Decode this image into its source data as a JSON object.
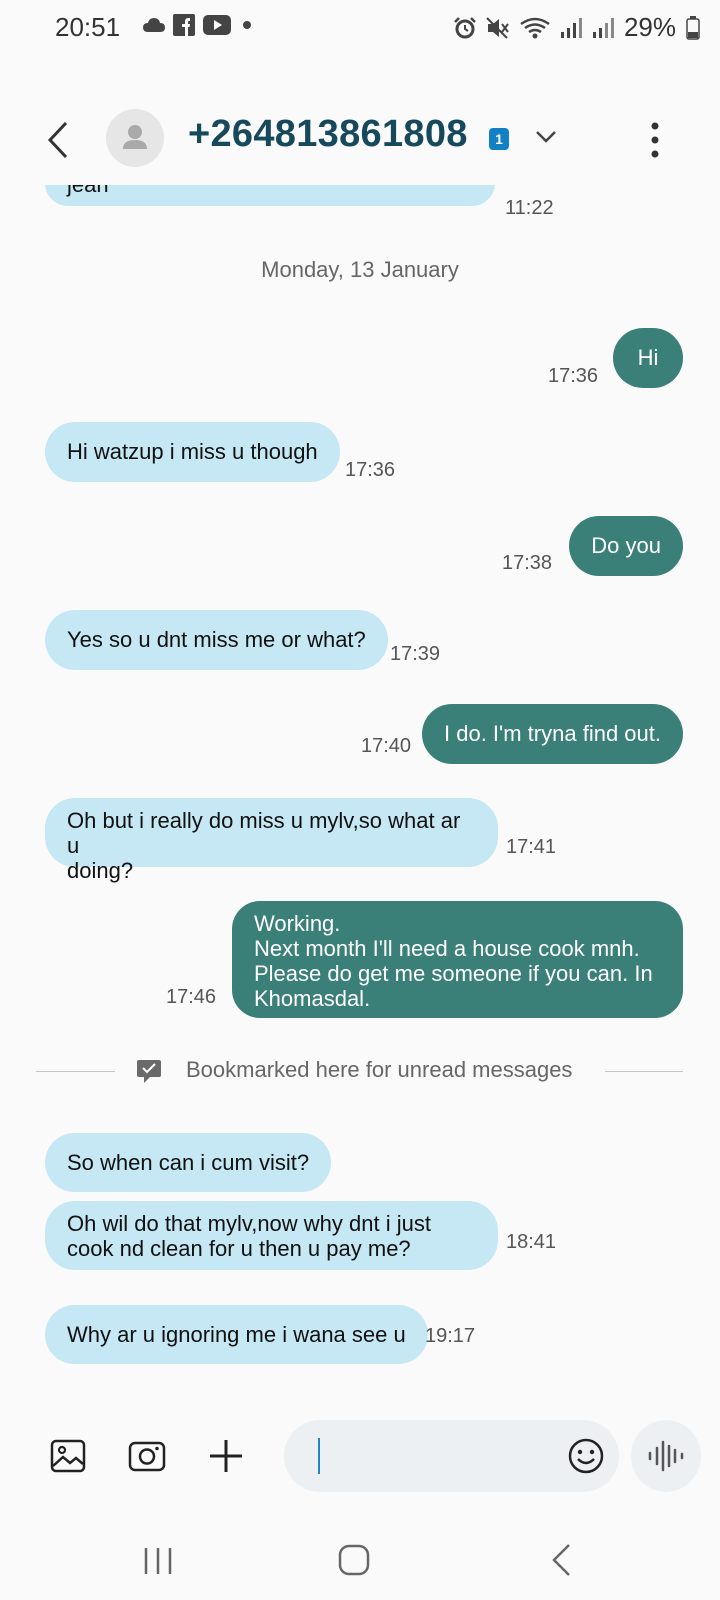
{
  "status_bar": {
    "time": "20:51",
    "battery": "29%"
  },
  "header": {
    "contact": "+264813861808",
    "sim_badge": "1"
  },
  "messages": [
    {
      "text": "jean",
      "time": "11:22"
    },
    {
      "date": "Monday, 13 January"
    },
    {
      "text": "Hi",
      "time": "17:36"
    },
    {
      "text": "Hi watzup i miss u though",
      "time": "17:36"
    },
    {
      "text": "Do you",
      "time": "17:38"
    },
    {
      "text": "Yes so u dnt miss me or what?",
      "time": "17:39"
    },
    {
      "text": "I do. I'm tryna find out.",
      "time": "17:40"
    },
    {
      "lines": [
        "Oh but i really do miss u mylv,so what ar u",
        "doing?"
      ],
      "time": "17:41"
    },
    {
      "lines": [
        "Working.",
        "Next month I'll need a house cook mnh.",
        "Please do get me someone if you can. In",
        "Khomasdal."
      ],
      "time": "17:46"
    },
    {
      "bookmark": "Bookmarked here for unread messages"
    },
    {
      "text": "So when can i cum visit?"
    },
    {
      "lines": [
        "Oh wil do that mylv,now why dnt i just",
        "cook nd clean for u then u pay me?"
      ],
      "time": "18:41"
    },
    {
      "text": "Why ar u ignoring me i wana see u",
      "time": "19:17"
    }
  ],
  "composer": {
    "value": ""
  },
  "colors": {
    "incoming": "#c5e8f4",
    "outgoing": "#3a8078",
    "header_text": "#17495c",
    "badge": "#1380c4"
  }
}
